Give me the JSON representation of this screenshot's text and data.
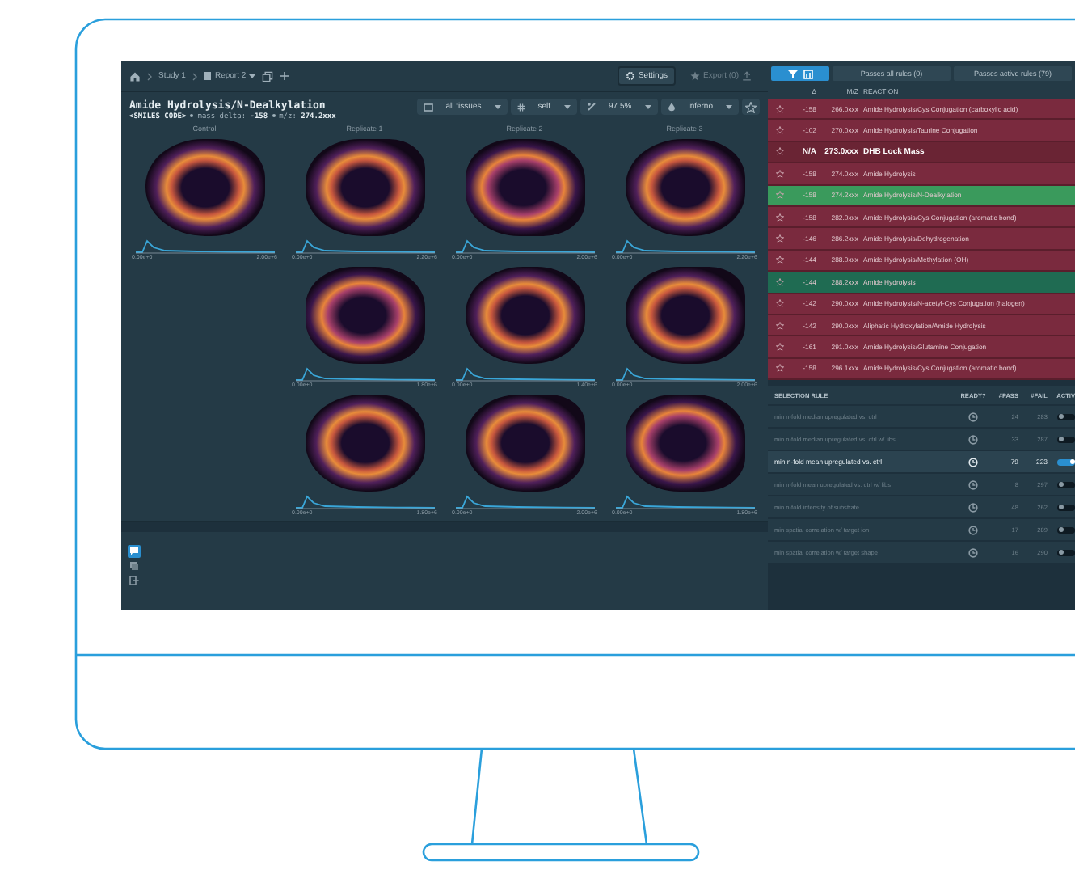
{
  "breadcrumb": [
    {
      "kind": "study",
      "label": "Study 1"
    },
    {
      "kind": "report",
      "label": "Report 2"
    }
  ],
  "toolbar": {
    "settings": "Settings",
    "export": {
      "label": "Export (0)",
      "disabled": true
    }
  },
  "title": "Amide Hydrolysis/N-Dealkylation",
  "subtitle": [
    "**<SMILES CODE>**",
    "mass delta: **-158**",
    "m/z: **274.2xxx**"
  ],
  "filters": [
    {
      "kind": "tissues",
      "label": "all tissues"
    },
    {
      "kind": "normalization",
      "label": "self"
    },
    {
      "kind": "percentile",
      "label": "97.5%"
    },
    {
      "kind": "colormap",
      "label": "inferno"
    }
  ],
  "columns": [
    "Control",
    "Replicate 1",
    "Replicate 2",
    "Replicate 3"
  ],
  "image_rows": [
    [
      {
        "min": "0.00e+0",
        "max": "2.00e+6"
      },
      {
        "min": "0.00e+0",
        "max": "2.20e+6"
      },
      {
        "min": "0.00e+0",
        "max": "2.00e+6"
      },
      {
        "min": "0.00e+0",
        "max": "2.20e+6"
      }
    ],
    [
      null,
      {
        "min": "0.00e+0",
        "max": "1.80e+6"
      },
      {
        "min": "0.00e+0",
        "max": "1.40e+6"
      },
      {
        "min": "0.00e+0",
        "max": "2.00e+6"
      }
    ],
    [
      null,
      {
        "min": "0.00e+0",
        "max": "1.80e+6"
      },
      {
        "min": "0.00e+0",
        "max": "2.00e+6"
      },
      {
        "min": "0.00e+0",
        "max": "1.80e+6"
      }
    ]
  ],
  "bottom_tools": [
    {
      "selected": true
    },
    {
      "selected": false
    },
    {
      "selected": false
    }
  ],
  "side_tabs": [
    {
      "kind": "icons",
      "selected": true
    },
    {
      "kind": "text",
      "label": "Passes all rules (0)",
      "selected": false
    },
    {
      "kind": "text",
      "label": "Passes active rules (79)",
      "selected": false
    }
  ],
  "reaction_columns": [
    "Δ",
    "M/Z",
    "REACTION"
  ],
  "reactions": [
    {
      "kind": "reaction",
      "passes": false,
      "selected": false,
      "delta": "-158",
      "mz": "266.0xxx",
      "reaction": "Amide Hydrolysis/Cys Conjugation (carboxylic acid)"
    },
    {
      "kind": "reaction",
      "passes": false,
      "selected": false,
      "delta": "-102",
      "mz": "270.0xxx",
      "reaction": "Amide Hydrolysis/Taurine Conjugation"
    },
    {
      "kind": "lock_mass",
      "passes": false,
      "selected": false,
      "delta": "N/A",
      "mz": "273.0xxx",
      "reaction": "DHB Lock Mass"
    },
    {
      "kind": "reaction",
      "passes": false,
      "selected": false,
      "delta": "-158",
      "mz": "274.0xxx",
      "reaction": "Amide Hydrolysis"
    },
    {
      "kind": "reaction",
      "passes": true,
      "selected": true,
      "delta": "-158",
      "mz": "274.2xxx",
      "reaction": "Amide Hydrolysis/N-Dealkylation"
    },
    {
      "kind": "reaction",
      "passes": false,
      "selected": false,
      "delta": "-158",
      "mz": "282.0xxx",
      "reaction": "Amide Hydrolysis/Cys Conjugation (aromatic bond)"
    },
    {
      "kind": "reaction",
      "passes": false,
      "selected": false,
      "delta": "-146",
      "mz": "286.2xxx",
      "reaction": "Amide Hydrolysis/Dehydrogenation"
    },
    {
      "kind": "reaction",
      "passes": false,
      "selected": false,
      "delta": "-144",
      "mz": "288.0xxx",
      "reaction": "Amide Hydrolysis/Methylation (OH)"
    },
    {
      "kind": "reaction",
      "passes": true,
      "selected": false,
      "delta": "-144",
      "mz": "288.2xxx",
      "reaction": "Amide Hydrolysis"
    },
    {
      "kind": "reaction",
      "passes": false,
      "selected": false,
      "delta": "-142",
      "mz": "290.0xxx",
      "reaction": "Amide Hydrolysis/N-acetyl-Cys Conjugation (halogen)"
    },
    {
      "kind": "reaction",
      "passes": false,
      "selected": false,
      "delta": "-142",
      "mz": "290.0xxx",
      "reaction": "Aliphatic Hydroxylation/Amide Hydrolysis"
    },
    {
      "kind": "reaction",
      "passes": false,
      "selected": false,
      "delta": "-161",
      "mz": "291.0xxx",
      "reaction": "Amide Hydrolysis/Glutamine Conjugation"
    },
    {
      "kind": "reaction",
      "passes": false,
      "selected": false,
      "delta": "-158",
      "mz": "296.1xxx",
      "reaction": "Amide Hydrolysis/Cys Conjugation (aromatic bond)"
    }
  ],
  "rule_columns": [
    "SELECTION RULE",
    "READY?",
    "#PASS",
    "#FAIL",
    "ACTIV"
  ],
  "rules": [
    {
      "name": "min n-fold median upregulated vs. ctrl",
      "pass": "24",
      "fail": "283",
      "active": false
    },
    {
      "name": "min n-fold median upregulated vs. ctrl w/ libs",
      "pass": "33",
      "fail": "287",
      "active": false
    },
    {
      "name": "min n-fold mean upregulated vs. ctrl",
      "pass": "79",
      "fail": "223",
      "active": true
    },
    {
      "name": "min n-fold mean upregulated vs. ctrl w/ libs",
      "pass": "8",
      "fail": "297",
      "active": false
    },
    {
      "name": "min n-fold intensity of substrate",
      "pass": "48",
      "fail": "262",
      "active": false
    },
    {
      "name": "min spatial correlation w/ target ion",
      "pass": "17",
      "fail": "289",
      "active": false
    },
    {
      "name": "min spatial correlation w/ target shape",
      "pass": "16",
      "fail": "290",
      "active": false
    }
  ]
}
